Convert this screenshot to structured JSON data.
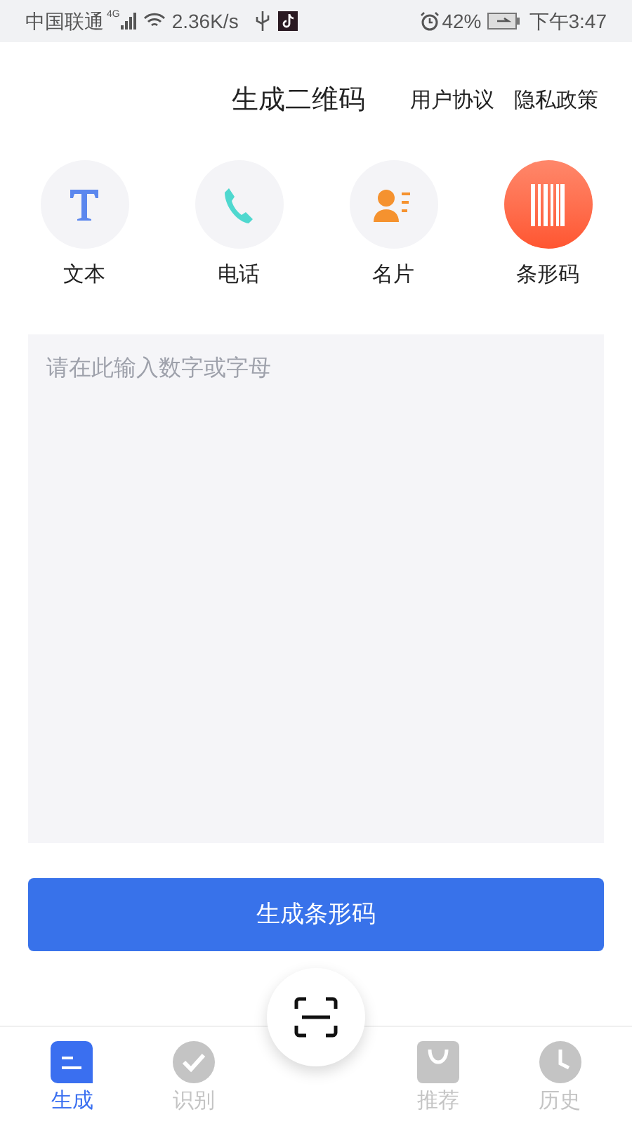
{
  "status_bar": {
    "carrier": "中国联通",
    "network": "4G",
    "speed": "2.36K/s",
    "battery": "42%",
    "time": "下午3:47"
  },
  "header": {
    "title": "生成二维码",
    "links": [
      "用户协议",
      "隐私政策"
    ]
  },
  "types": [
    {
      "kind": "text",
      "label": "文本",
      "selected": false
    },
    {
      "kind": "phone",
      "label": "电话",
      "selected": false
    },
    {
      "kind": "card",
      "label": "名片",
      "selected": false
    },
    {
      "kind": "barcode",
      "label": "条形码",
      "selected": true
    }
  ],
  "input": {
    "placeholder": "请在此输入数字或字母"
  },
  "generate_button": "生成条形码",
  "nav": [
    {
      "kind": "generate",
      "label": "生成",
      "selected": true
    },
    {
      "kind": "recognize",
      "label": "识别",
      "selected": false
    },
    {
      "kind": "scan",
      "selected": false
    },
    {
      "kind": "recommend",
      "label": "推荐",
      "selected": false
    },
    {
      "kind": "history",
      "label": "历史",
      "selected": false
    }
  ]
}
